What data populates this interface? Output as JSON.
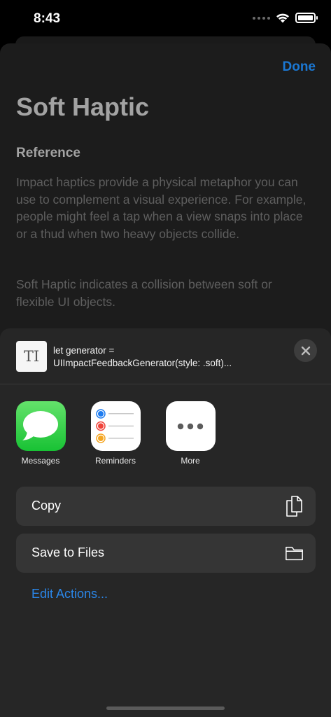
{
  "status_bar": {
    "time": "8:43",
    "icons": [
      "cellular-dots-icon",
      "wifi-icon",
      "battery-icon"
    ]
  },
  "detail": {
    "done_label": "Done",
    "title": "Soft Haptic",
    "subtitle": "Reference",
    "paragraph1": "Impact haptics provide a physical metaphor you can use to complement a visual experience. For example, people might feel a tap when a view snaps into place or a thud when two heavy objects collide.",
    "paragraph2": "Soft Haptic indicates a collision between soft or flexible UI objects."
  },
  "share_sheet": {
    "preview": {
      "thumb_text": "TI",
      "line1": "let generator =",
      "line2": "UIImpactFeedbackGenerator(style: .soft)..."
    },
    "apps": [
      {
        "label": "Messages",
        "icon": "messages-icon"
      },
      {
        "label": "Reminders",
        "icon": "reminders-icon"
      },
      {
        "label": "More",
        "icon": "more-icon"
      }
    ],
    "actions": [
      {
        "label": "Copy",
        "icon": "copy-icon"
      },
      {
        "label": "Save to Files",
        "icon": "folder-icon"
      }
    ],
    "edit_actions_label": "Edit Actions..."
  },
  "colors": {
    "accent": "#1b78d4",
    "link": "#2a86e8",
    "sheet_bg": "#262626",
    "row_bg": "#353535",
    "messages_green": "#18c234",
    "reminder_blue": "#1e7cf0",
    "reminder_red": "#f0433a",
    "reminder_orange": "#f5a623"
  }
}
